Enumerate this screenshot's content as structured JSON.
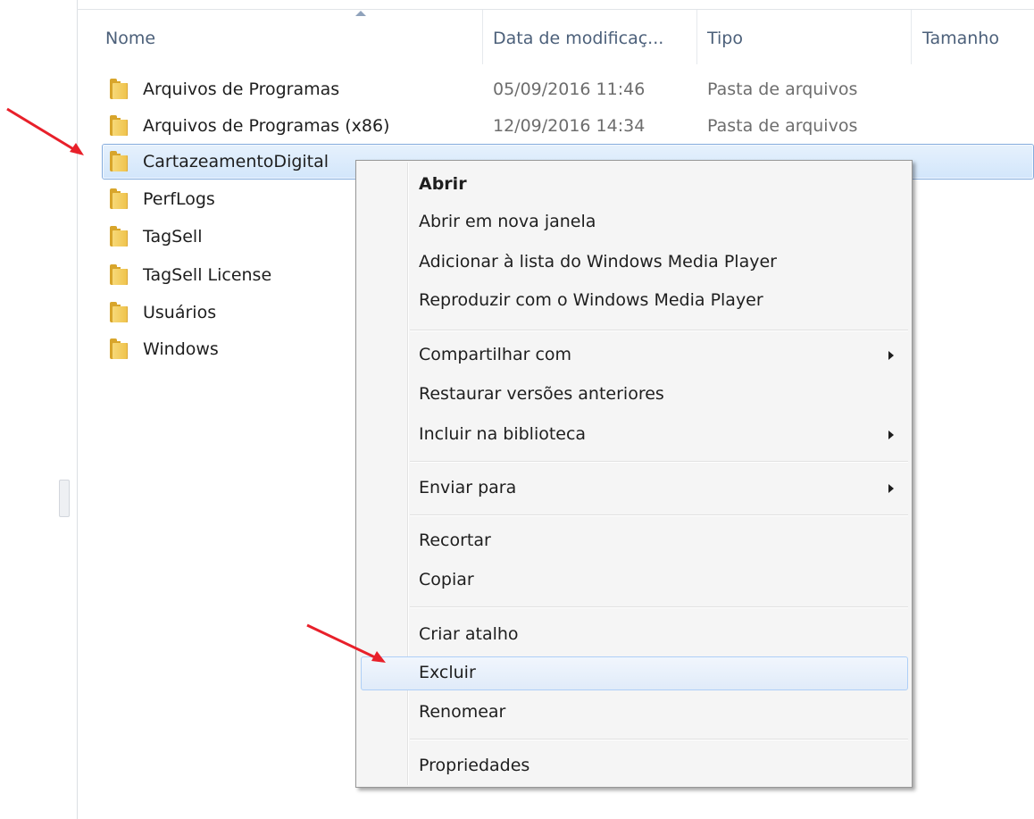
{
  "columns": {
    "name": "Nome",
    "date": "Data de modificaç...",
    "type": "Tipo",
    "size": "Tamanho"
  },
  "files": [
    {
      "name": "Arquivos de Programas",
      "date": "05/09/2016 11:46",
      "type": "Pasta de arquivos"
    },
    {
      "name": "Arquivos de Programas (x86)",
      "date": "12/09/2016 14:34",
      "type": "Pasta de arquivos"
    },
    {
      "name": "CartazeamentoDigital",
      "date": "",
      "type": "",
      "selected": true
    },
    {
      "name": "PerfLogs",
      "date": "",
      "type": ""
    },
    {
      "name": "TagSell",
      "date": "",
      "type": ""
    },
    {
      "name": "TagSell License",
      "date": "",
      "type": ""
    },
    {
      "name": "Usuários",
      "date": "",
      "type": ""
    },
    {
      "name": "Windows",
      "date": "",
      "type": ""
    }
  ],
  "context_menu": {
    "items": [
      {
        "label": "Abrir",
        "bold": true
      },
      {
        "label": "Abrir em nova janela"
      },
      {
        "label": "Adicionar à lista do Windows Media Player"
      },
      {
        "label": "Reproduzir com o Windows Media Player"
      },
      {
        "label": "Compartilhar com",
        "submenu": true
      },
      {
        "label": "Restaurar versões anteriores"
      },
      {
        "label": "Incluir na biblioteca",
        "submenu": true
      },
      {
        "label": "Enviar para",
        "submenu": true
      },
      {
        "label": "Recortar"
      },
      {
        "label": "Copiar"
      },
      {
        "label": "Criar atalho"
      },
      {
        "label": "Excluir",
        "highlighted": true
      },
      {
        "label": "Renomear"
      },
      {
        "label": "Propriedades"
      }
    ]
  },
  "colors": {
    "annotation_arrow": "#e8202a",
    "selection_border": "#84acdd",
    "header_text": "#4c607a"
  },
  "icons": {
    "folder": "folder-icon",
    "sort": "sort-ascending-icon",
    "submenu": "submenu-arrow-icon",
    "annotation": "red-arrow-icon"
  }
}
